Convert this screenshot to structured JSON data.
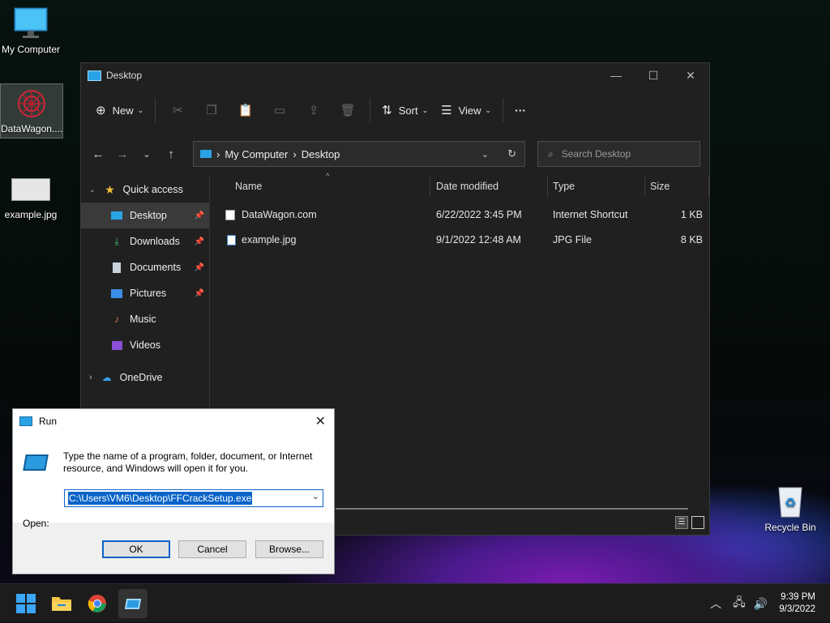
{
  "desktop": {
    "icons": [
      {
        "label": "My Computer"
      },
      {
        "label": "DataWagon...."
      },
      {
        "label": "example.jpg"
      },
      {
        "label": "Recycle Bin"
      }
    ]
  },
  "explorer": {
    "title": "Desktop",
    "toolbar": {
      "new_label": "New",
      "sort_label": "Sort",
      "view_label": "View",
      "more_label": "···"
    },
    "address": {
      "crumbs": [
        "My Computer",
        "Desktop"
      ]
    },
    "search": {
      "placeholder": "Search Desktop"
    },
    "nav": {
      "quick_access": "Quick access",
      "items": [
        {
          "label": "Desktop",
          "pinned": true,
          "selected": true
        },
        {
          "label": "Downloads",
          "pinned": true
        },
        {
          "label": "Documents",
          "pinned": true
        },
        {
          "label": "Pictures",
          "pinned": true
        },
        {
          "label": "Music"
        },
        {
          "label": "Videos"
        }
      ],
      "onedrive": "OneDrive"
    },
    "columns": {
      "name": "Name",
      "date": "Date modified",
      "type": "Type",
      "size": "Size"
    },
    "files": [
      {
        "name": "DataWagon.com",
        "date": "6/22/2022 3:45 PM",
        "type": "Internet Shortcut",
        "size": "1 KB"
      },
      {
        "name": "example.jpg",
        "date": "9/1/2022 12:48 AM",
        "type": "JPG File",
        "size": "8 KB"
      }
    ]
  },
  "run": {
    "title": "Run",
    "description": "Type the name of a program, folder, document, or Internet resource, and Windows will open it for you.",
    "open_label": "Open:",
    "value": "C:\\Users\\VM6\\Desktop\\FFCrackSetup.exe",
    "ok_label": "OK",
    "cancel_label": "Cancel",
    "browse_label": "Browse..."
  },
  "taskbar": {
    "time": "9:39 PM",
    "date": "9/3/2022"
  },
  "colors": {
    "accent": "#0a64c8",
    "explorer_bg": "#202020"
  }
}
